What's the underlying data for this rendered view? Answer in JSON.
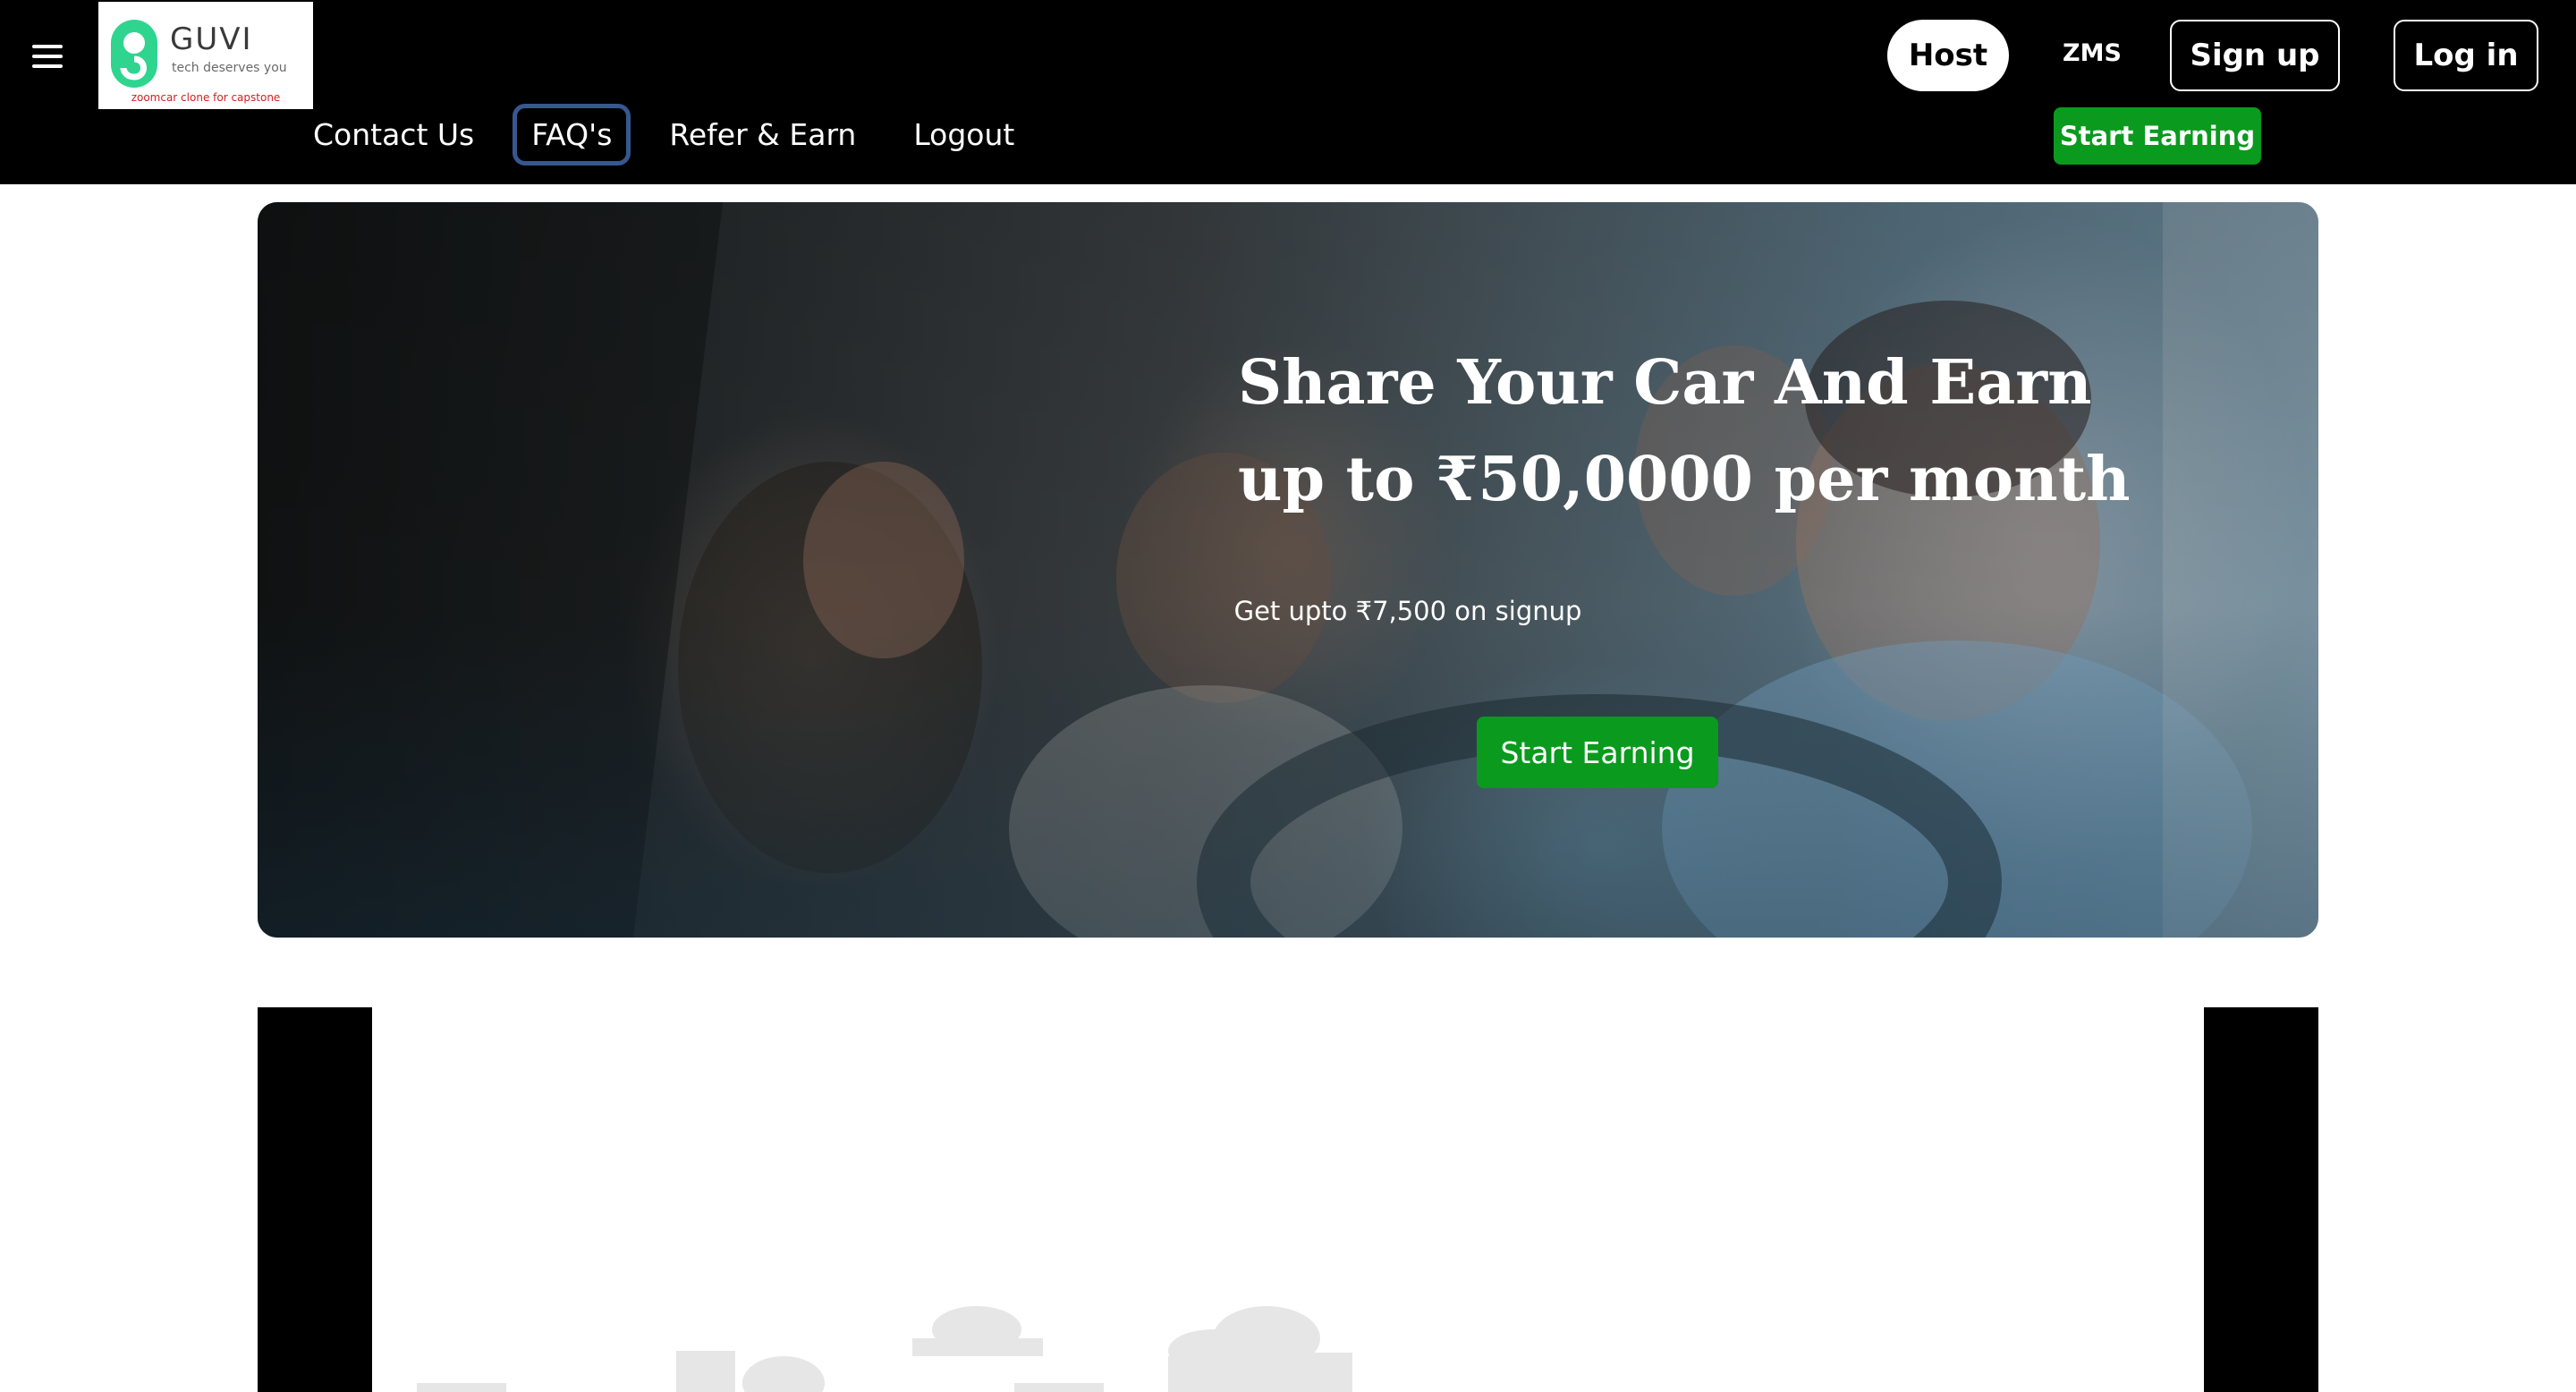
{
  "header": {
    "menu_icon": "hamburger-menu-icon",
    "logo": {
      "name": "GUVI",
      "tagline": "tech deserves you",
      "caption": "zoomcar clone for capstone"
    },
    "nav_links": [
      {
        "label": "Contact Us"
      },
      {
        "label": "FAQ's"
      },
      {
        "label": "Refer & Earn"
      },
      {
        "label": "Logout"
      }
    ],
    "host_label": "Host",
    "zms_label": "ZMS",
    "signup_label": "Sign up",
    "login_label": "Log in",
    "start_earning_label": "Start Earning"
  },
  "hero": {
    "title_line1": "Share Your Car And Earn",
    "title_line2": "up to ₹50,0000 per month",
    "subtitle": "Get upto ₹7,500 on signup",
    "cta_label": "Start Earning"
  },
  "colors": {
    "nav_background": "#000000",
    "accent_green": "#0a9a1e",
    "focus_ring": "#36588e",
    "logo_green": "#2fd58f"
  }
}
